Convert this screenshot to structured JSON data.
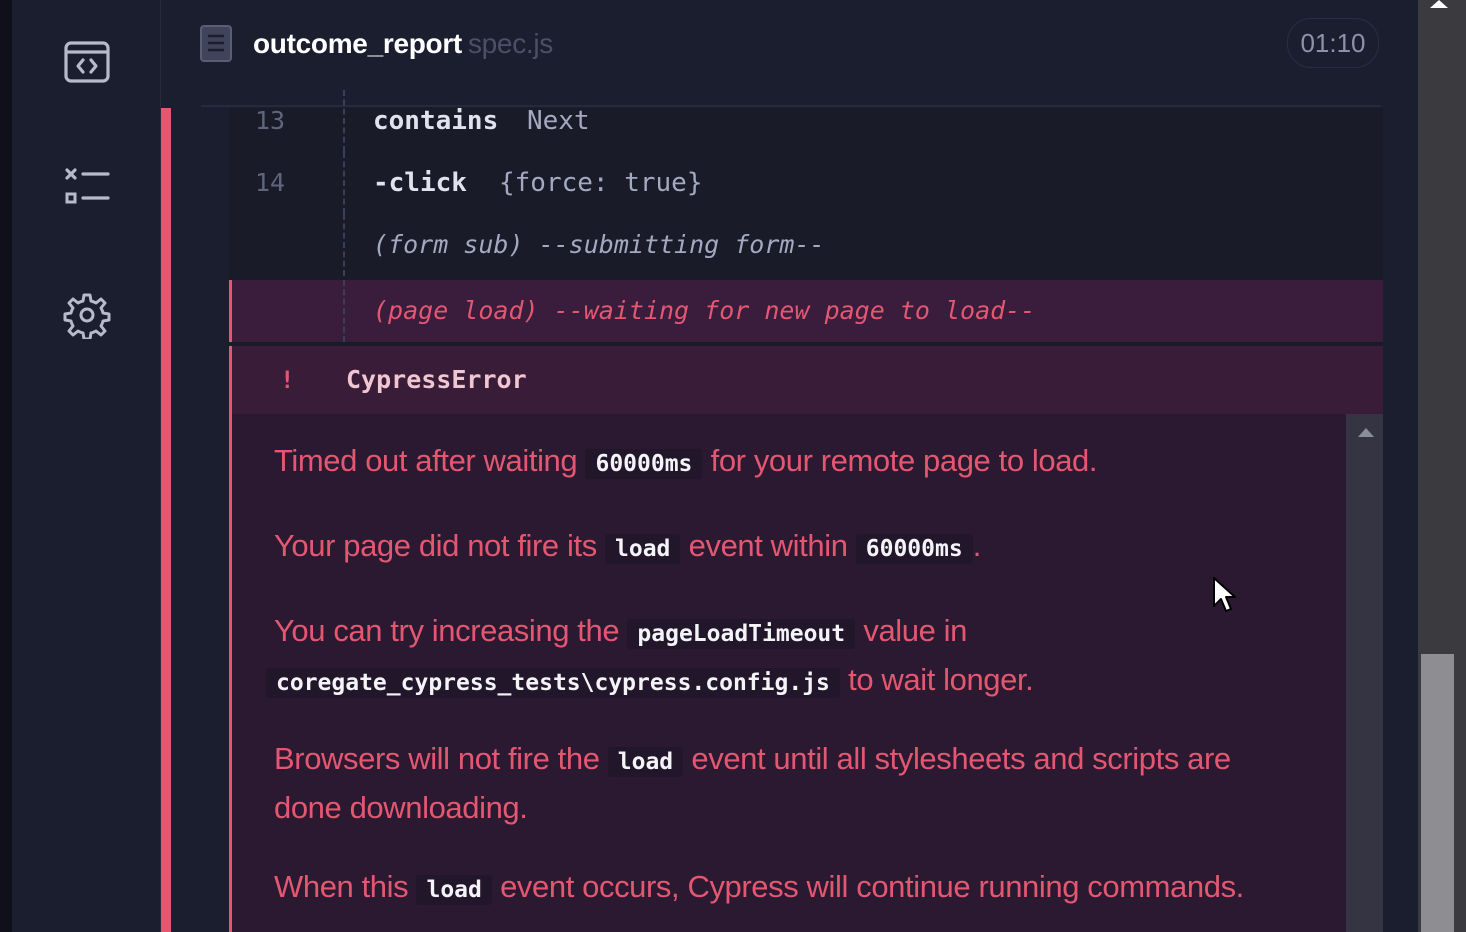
{
  "header": {
    "spec_name": "outcome_report",
    "spec_ext": "spec.js",
    "timer": "01:10"
  },
  "sidebar": {
    "items": [
      {
        "icon": "code-window-icon",
        "label": "Specs"
      },
      {
        "icon": "runs-list-icon",
        "label": "Runs"
      },
      {
        "icon": "gear-icon",
        "label": "Settings"
      }
    ]
  },
  "command_log": {
    "rows": [
      {
        "num": "13",
        "name": "contains",
        "message": "Next"
      },
      {
        "num": "14",
        "name": "-click",
        "message": "{force: true}"
      },
      {
        "num": "",
        "event": "(form sub)",
        "message": "--submitting form--"
      },
      {
        "num": "",
        "event": "(page load)",
        "message": "--waiting for new page to load--",
        "state": "failed"
      }
    ]
  },
  "error": {
    "bang": "!",
    "title": "CypressError",
    "p1": {
      "pre": "Timed out after waiting",
      "code": "60000ms",
      "post": "for your remote page to load."
    },
    "p2": {
      "pre": "Your page did not fire its",
      "code1": "load",
      "mid": "event within",
      "code2": "60000ms",
      "post": "."
    },
    "p3": {
      "pre": "You can try increasing the",
      "code1": "pageLoadTimeout",
      "mid": "value in",
      "code2": "coregate_cypress_tests\\cypress.config.js",
      "post": "to wait longer."
    },
    "p4": {
      "pre": "Browsers will not fire the",
      "code": "load",
      "post": "event until all stylesheets and scripts are done downloading."
    },
    "p5": {
      "pre": "When this",
      "code": "load",
      "post": "event occurs, Cypress will continue running commands."
    }
  },
  "colors": {
    "accent_fail": "#e45770",
    "background": "#1b1e2e",
    "error_bg": "#2b1932"
  }
}
